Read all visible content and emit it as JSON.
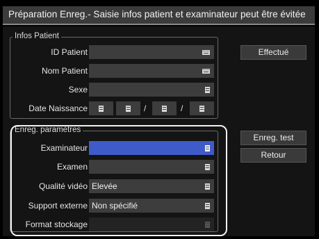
{
  "title": "Préparation Enreg.- Saisie infos patient et examinateur peut être évitée",
  "patient": {
    "legend": "Infos Patient",
    "id_label": "ID Patient",
    "name_label": "Nom Patient",
    "sex_label": "Sexe",
    "birth_label": "Date Naissance",
    "date_separator": "/"
  },
  "record": {
    "legend": "Enreg. paramètres",
    "examiner_label": "Examinateur",
    "exam_label": "Examen",
    "video_label": "Qualité vidéo",
    "video_value": "Elevée",
    "external_label": "Support externe",
    "external_value": "Non spécifié",
    "format_label": "Format stockage"
  },
  "buttons": {
    "done": "Effectué",
    "test": "Enreg. test",
    "back": "Retour"
  },
  "icons": {
    "keyboard": "keyboard-icon",
    "menu": "list-menu-icon"
  },
  "colors": {
    "selected_field": "#3f5bc9",
    "field": "#3d3d3d",
    "title_bar": "#3b3b3b"
  }
}
